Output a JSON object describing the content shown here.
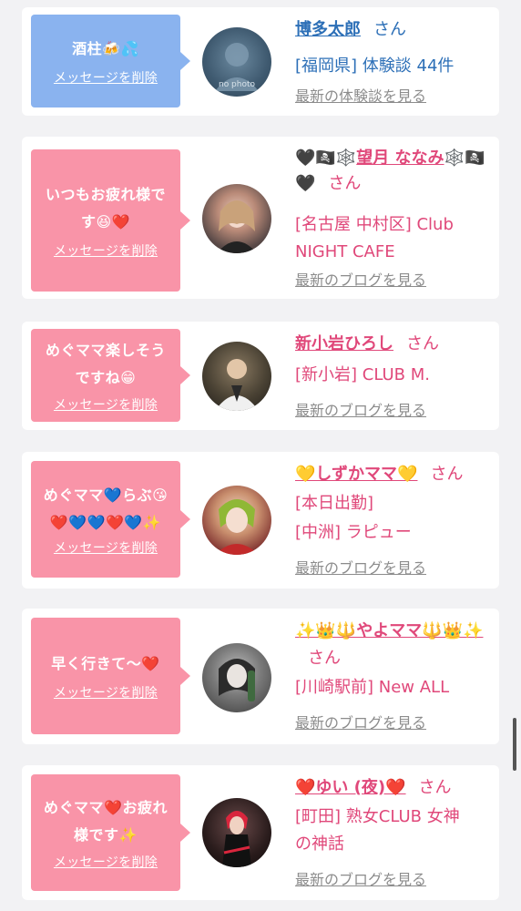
{
  "cards": [
    {
      "message": "酒柱🍻💦",
      "delete_label": "メッセージを削除",
      "name_prefix": "",
      "name": "博多太郎",
      "san": "さん",
      "details": [
        "[福岡県] 体験談 44件"
      ],
      "link": "最新の体験談を見る",
      "avatar_text": "no photo",
      "theme": "blue"
    },
    {
      "message": "いつもお疲れ様です😆❤️",
      "delete_label": "メッセージを削除",
      "name_prefix": "🖤🏴‍☠️🕸️",
      "name": "望月 ななみ",
      "name_suffix": "🕸️🏴‍☠️🖤",
      "san": "さん",
      "details": [
        "[名古屋 中村区] Club",
        "NIGHT CAFE"
      ],
      "link": "最新のブログを見る",
      "theme": "pink"
    },
    {
      "message": "めぐママ楽しそうですね😁",
      "delete_label": "メッセージを削除",
      "name": "新小岩ひろし",
      "san": "さん",
      "details": [
        "[新小岩] CLUB M."
      ],
      "link": "最新のブログを見る",
      "theme": "pink"
    },
    {
      "message": "めぐママ💙らぶ😘❤️💙💙❤️💙✨",
      "delete_label": "メッセージを削除",
      "name": "💛しずかママ💛",
      "san": "さん",
      "details": [
        "[本日出勤]",
        "[中洲] ラピュー"
      ],
      "link": "最新のブログを見る",
      "theme": "pink"
    },
    {
      "message": "早く行きて〜❤️",
      "delete_label": "メッセージを削除",
      "name": "✨👑🔱やよママ🔱👑✨",
      "san": "さん",
      "details": [
        "[川崎駅前] New ALL"
      ],
      "link": "最新のブログを見る",
      "theme": "pink"
    },
    {
      "message": "めぐママ❤️お疲れ様です✨",
      "delete_label": "メッセージを削除",
      "name": "❤️ゆい (夜)❤️",
      "san": "さん",
      "details": [
        "[町田] 熟女CLUB 女神",
        "の神話"
      ],
      "link": "最新のブログを見る",
      "theme": "pink"
    }
  ]
}
